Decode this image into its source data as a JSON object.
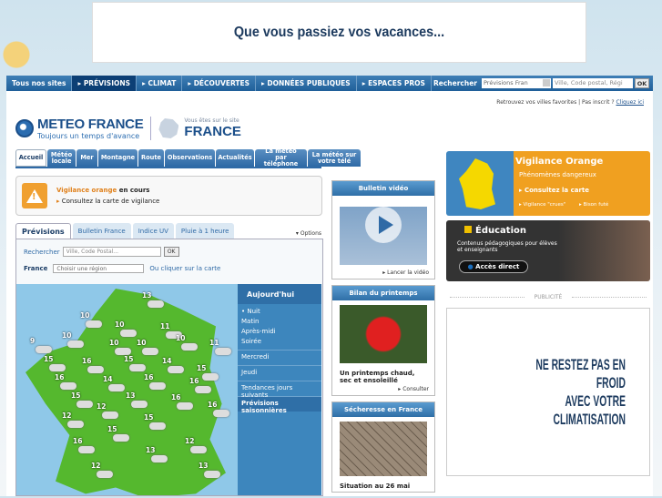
{
  "banner": {
    "text": "Que vous passiez vos vacances..."
  },
  "topnav": {
    "items": [
      "Tous nos sites",
      "▸ PRÉVISIONS",
      "▸ CLIMAT",
      "▸ DÉCOUVERTES",
      "▸ DONNÉES PUBLIQUES",
      "▸ ESPACES PROS"
    ],
    "search_label": "Rechercher",
    "search_select": "Prévisions Fran",
    "search_placeholder": "Ville, Code postal, Régi",
    "ok": "OK"
  },
  "header": {
    "brand": "METEO FRANCE",
    "slogan": "Toujours un temps d'avance",
    "site_note": "Vous êtes sur le site",
    "site": "FRANCE",
    "favs_text": "Retrouvez vos villes favorites | Pas inscrit ?",
    "favs_link": "Cliquez ici"
  },
  "tabs": [
    "Accueil",
    "Météo locale",
    "Mer",
    "Montagne",
    "Route",
    "Observations",
    "Actualités",
    "La météo par téléphone",
    "La météo sur votre télé"
  ],
  "vigilance": {
    "title": "Vigilance orange",
    "suffix": " en cours",
    "link": "Consultez la carte de vigilance"
  },
  "previsions": {
    "tabs": [
      "Prévisions",
      "Bulletin France",
      "Indice UV",
      "Pluie à 1 heure"
    ],
    "options": "▾ Options",
    "search_label": "Rechercher",
    "search_placeholder": "Ville, Code Postal...",
    "ok": "OK",
    "region_label": "France",
    "region_select": "Choisir une région",
    "region_alt": "Ou cliquer sur la carte",
    "side": {
      "header": "Aujourd'hui",
      "parts": [
        "Nuit",
        "Matin",
        "Après-midi",
        "Soirée"
      ],
      "rows": [
        "Mercredi",
        "Jeudi",
        "Tendances jours suivants",
        "Prévisions saisonnières"
      ]
    },
    "temps": [
      "13",
      "10",
      "10",
      "11",
      "10",
      "9",
      "10",
      "10",
      "10",
      "11",
      "15",
      "16",
      "15",
      "14",
      "15",
      "16",
      "14",
      "16",
      "16",
      "15",
      "13",
      "16",
      "12",
      "16",
      "12",
      "15",
      "15",
      "12",
      "16",
      "13",
      "12",
      "13"
    ]
  },
  "bulletin": {
    "title": "Bulletin vidéo",
    "link": "Lancer la vidéo"
  },
  "bilan": {
    "title": "Bilan du printemps",
    "caption": "Un printemps chaud, sec et ensoleillé",
    "link": "Consulter"
  },
  "secheresse": {
    "title": "Sécheresse en France",
    "caption": "Situation au 26 mai"
  },
  "vigilance_card": {
    "title": "Vigilance Orange",
    "sub": "Phénomènes dangereux",
    "link": "Consultez la carte",
    "link2": "Vigilance \"crues\"",
    "link3": "Bison futé"
  },
  "education": {
    "title": "Éducation",
    "desc": "Contenus pédagogiques pour élèves et enseignants",
    "button": "Accès direct"
  },
  "pub": {
    "label": "PUBLICITÉ",
    "line1": "NE RESTEZ PAS EN FROID",
    "line2": "AVEC VOTRE",
    "line3": "CLIMATISATION"
  }
}
